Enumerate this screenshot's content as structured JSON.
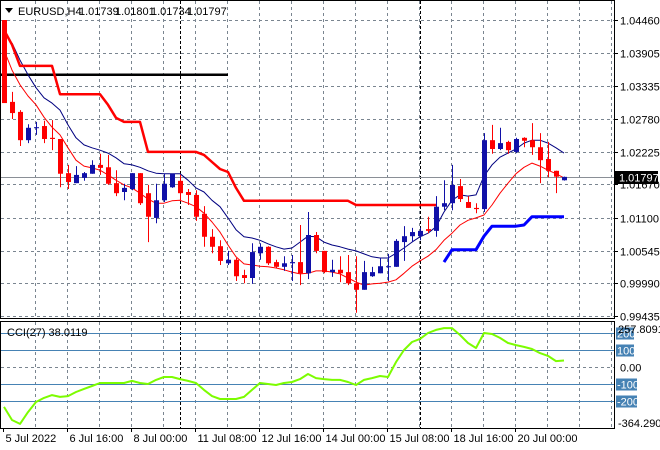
{
  "header": {
    "symbol": "EURUSD,H4",
    "open": "1.01739",
    "high": "1.01801",
    "low": "1.01734",
    "close": "1.01797"
  },
  "price_axis": {
    "labels": [
      "1.04460",
      "1.03905",
      "1.03335",
      "1.02780",
      "1.02225",
      "1.01670",
      "1.01100",
      "1.00545",
      "0.99990",
      "0.99435"
    ],
    "current_price": "1.01797"
  },
  "cci": {
    "title": "CCI(27) 38.0119",
    "max_label": "257.8091",
    "min_label": "-364.2903",
    "level_labels": [
      "200",
      "100",
      "0.00",
      "-100",
      "-200"
    ]
  },
  "time_axis": {
    "labels": [
      "5 Jul 2022",
      "6 Jul 16:00",
      "8 Jul 00:00",
      "11 Jul 08:00",
      "12 Jul 16:00",
      "14 Jul 00:00",
      "15 Jul 08:00",
      "18 Jul 16:00",
      "20 Jul 00:00"
    ]
  },
  "colors": {
    "bull": "#1010a8",
    "bear": "#ff0000",
    "ma_fast": "#ff0000",
    "ma_slow": "#000080",
    "resistance": "#ff0000",
    "support": "#0000ff",
    "cci_line": "#7cfc00",
    "cci_levels": "#4682b4",
    "grid": "#7a8590"
  },
  "chart_data": [
    {
      "type": "candlestick",
      "title": "EURUSD,H4",
      "ylim": [
        0.99435,
        1.0446
      ],
      "grid": true,
      "label_every": 8,
      "day_separators": [
        22,
        52
      ],
      "horizontal_line": 1.0353,
      "current_price": 1.01797,
      "ohlc": [
        [
          1.0446,
          1.0446,
          1.0305,
          1.0305
        ],
        [
          1.0307,
          1.0324,
          1.0278,
          1.0288
        ],
        [
          1.029,
          1.0293,
          1.0232,
          1.0242
        ],
        [
          1.0242,
          1.0269,
          1.0237,
          1.0263
        ],
        [
          1.0263,
          1.0273,
          1.0251,
          1.0264
        ],
        [
          1.0266,
          1.0275,
          1.0237,
          1.0244
        ],
        [
          1.0246,
          1.0276,
          1.0225,
          1.0244
        ],
        [
          1.0244,
          1.0244,
          1.0162,
          1.0185
        ],
        [
          1.0186,
          1.02,
          1.0159,
          1.0171
        ],
        [
          1.0169,
          1.0198,
          1.0169,
          1.0183
        ],
        [
          1.0178,
          1.0188,
          1.0173,
          1.0186
        ],
        [
          1.0185,
          1.0208,
          1.0185,
          1.02
        ],
        [
          1.02,
          1.0219,
          1.0183,
          1.0195
        ],
        [
          1.0196,
          1.0217,
          1.0166,
          1.0168
        ],
        [
          1.0169,
          1.0191,
          1.0147,
          1.0152
        ],
        [
          1.0154,
          1.0168,
          1.014,
          1.0161
        ],
        [
          1.0159,
          1.0186,
          1.0157,
          1.0186
        ],
        [
          1.0186,
          1.0186,
          1.0132,
          1.0135
        ],
        [
          1.0152,
          1.0166,
          1.0069,
          1.0112
        ],
        [
          1.011,
          1.0168,
          1.0101,
          1.014
        ],
        [
          1.014,
          1.0185,
          1.0137,
          1.0168
        ],
        [
          1.0162,
          1.0185,
          1.0161,
          1.0185
        ],
        [
          1.0173,
          1.0183,
          1.014,
          1.0152
        ],
        [
          1.0154,
          1.0159,
          1.0132,
          1.0149
        ],
        [
          1.0149,
          1.0157,
          1.0105,
          1.0112
        ],
        [
          1.0117,
          1.013,
          1.0061,
          1.0078
        ],
        [
          1.0078,
          1.0091,
          1.005,
          1.0061
        ],
        [
          1.0062,
          1.0072,
          1.003,
          1.0037
        ],
        [
          1.0033,
          1.0054,
          1.003,
          1.0039
        ],
        [
          1.0039,
          1.0042,
          1.0003,
          1.0011
        ],
        [
          1.0013,
          1.0022,
          0.9999,
          1.0008
        ],
        [
          1.0008,
          1.0067,
          0.9998,
          1.0052
        ],
        [
          1.005,
          1.0067,
          1.0039,
          1.0061
        ],
        [
          1.0061,
          1.0062,
          1.003,
          1.0033
        ],
        [
          1.0035,
          1.0039,
          1.0025,
          1.0027
        ],
        [
          1.0027,
          1.0045,
          1.002,
          1.0033
        ],
        [
          1.0033,
          1.0047,
          1.0003,
          1.0035
        ],
        [
          1.0035,
          1.0098,
          0.9996,
          1.0016
        ],
        [
          1.0016,
          1.012,
          1.0006,
          1.0081
        ],
        [
          1.0081,
          1.0086,
          1.005,
          1.0054
        ],
        [
          1.0054,
          1.0054,
          1.0016,
          1.0018
        ],
        [
          1.0018,
          1.0039,
          1.001,
          1.0022
        ],
        [
          1.0022,
          1.0045,
          1.0001,
          1.0016
        ],
        [
          1.0018,
          1.0047,
          0.9996,
          0.9999
        ],
        [
          0.9999,
          1.0045,
          0.9949,
          0.9988
        ],
        [
          0.9988,
          1.0037,
          0.9988,
          1.0018
        ],
        [
          1.0011,
          1.0027,
          1.001,
          1.0018
        ],
        [
          1.0016,
          1.0042,
          1.0016,
          1.0028
        ],
        [
          1.0027,
          1.0049,
          1.0003,
          1.0028
        ],
        [
          1.0027,
          1.0074,
          1.0027,
          1.0071
        ],
        [
          1.0069,
          1.0096,
          1.0037,
          1.0079
        ],
        [
          1.0079,
          1.0093,
          1.0069,
          1.0086
        ],
        [
          1.0079,
          1.0093,
          1.0072,
          1.0088
        ],
        [
          1.0091,
          1.0112,
          1.0084,
          1.0088
        ],
        [
          1.0088,
          1.0147,
          1.0078,
          1.0129
        ],
        [
          1.0129,
          1.0174,
          1.0123,
          1.0135
        ],
        [
          1.0135,
          1.02,
          1.0123,
          1.0166
        ],
        [
          1.0164,
          1.0176,
          1.0137,
          1.0142
        ],
        [
          1.0137,
          1.0147,
          1.0127,
          1.0127
        ],
        [
          1.0127,
          1.0135,
          1.0118,
          1.0125
        ],
        [
          1.0125,
          1.0254,
          1.012,
          1.0242
        ],
        [
          1.0242,
          1.0268,
          1.0219,
          1.0227
        ],
        [
          1.0227,
          1.0263,
          1.0225,
          1.0237
        ],
        [
          1.0239,
          1.0241,
          1.0219,
          1.0225
        ],
        [
          1.0222,
          1.0246,
          1.022,
          1.0244
        ],
        [
          1.0246,
          1.0247,
          1.023,
          1.0241
        ],
        [
          1.0242,
          1.0271,
          1.0217,
          1.023
        ],
        [
          1.023,
          1.0254,
          1.0169,
          1.0208
        ],
        [
          1.021,
          1.0239,
          1.0179,
          1.019
        ],
        [
          1.019,
          1.019,
          1.0152,
          1.018
        ],
        [
          1.01739,
          1.01801,
          1.01734,
          1.01797
        ]
      ],
      "series": [
        {
          "name": "ma_slow",
          "values": [
            null,
            1.0407,
            1.0378,
            1.0353,
            1.0331,
            1.0314,
            1.0305,
            1.0293,
            1.0268,
            1.0246,
            1.0234,
            1.0229,
            1.0225,
            1.022,
            1.0212,
            1.0202,
            1.02,
            1.0196,
            1.019,
            1.0186,
            1.0185,
            1.0185,
            1.0185,
            1.0174,
            1.0161,
            1.0154,
            1.014,
            1.0129,
            1.011,
            1.009,
            1.0078,
            1.0076,
            1.0072,
            1.0066,
            1.0061,
            1.0057,
            1.0059,
            1.0069,
            1.0079,
            1.0078,
            1.0069,
            1.0064,
            1.0061,
            1.0057,
            1.0054,
            1.0049,
            1.0044,
            1.0042,
            1.0042,
            1.005,
            1.0059,
            1.0069,
            1.0078,
            1.0084,
            1.0095,
            1.012,
            1.014,
            1.0149,
            1.0147,
            1.0149,
            1.0181,
            1.02,
            1.0213,
            1.022,
            1.0227,
            1.0237,
            1.0242,
            1.0242,
            1.0237,
            1.0229,
            1.022
          ]
        },
        {
          "name": "ma_fast",
          "values": [
            1.0395,
            1.0361,
            1.0336,
            1.0317,
            1.0302,
            1.0281,
            1.0264,
            1.0251,
            1.0229,
            1.0208,
            1.0198,
            1.0195,
            1.0191,
            1.0183,
            1.0174,
            1.0166,
            1.0161,
            1.0152,
            1.0142,
            1.0135,
            1.0135,
            1.0139,
            1.014,
            1.0135,
            1.0129,
            1.0118,
            1.0103,
            1.0086,
            1.0064,
            1.0044,
            1.0032,
            1.003,
            1.0028,
            1.0027,
            1.0025,
            1.0022,
            1.0018,
            1.0015,
            1.0016,
            1.002,
            1.002,
            1.0018,
            1.0015,
            1.0008,
            1.0001,
            0.9996,
            0.9998,
            0.9999,
            1.0001,
            1.0005,
            1.0016,
            1.0028,
            1.0037,
            1.0045,
            1.0056,
            1.0072,
            1.0084,
            1.0098,
            1.0106,
            1.011,
            1.0115,
            1.0132,
            1.0152,
            1.0169,
            1.0185,
            1.0196,
            1.0203,
            1.0198,
            1.0191,
            1.0185,
            1.0178
          ]
        },
        {
          "name": "resistance",
          "values": [
            1.0429,
            1.0404,
            1.0368,
            1.0368,
            1.0368,
            1.0368,
            1.0368,
            1.032,
            1.032,
            1.032,
            1.032,
            1.032,
            1.032,
            1.0302,
            1.028,
            1.0273,
            1.0273,
            1.0273,
            1.0222,
            1.0222,
            1.0222,
            1.0222,
            1.0222,
            1.0222,
            1.0222,
            1.0217,
            1.0205,
            1.0193,
            1.0188,
            1.0161,
            1.0139,
            1.0139,
            1.0139,
            1.0139,
            1.0139,
            1.0139,
            1.0139,
            1.0139,
            1.0139,
            1.0139,
            1.0139,
            1.0139,
            1.0139,
            1.0139,
            1.0132,
            1.0132,
            1.0132,
            1.0132,
            1.0132,
            1.0132,
            1.0132,
            1.0132,
            1.0132,
            1.0132,
            1.0132,
            null,
            null,
            null,
            null,
            null,
            null,
            null,
            null,
            null,
            null,
            null,
            null,
            null,
            null,
            null,
            null
          ]
        },
        {
          "name": "support",
          "values": [
            null,
            null,
            null,
            null,
            null,
            null,
            null,
            null,
            null,
            null,
            null,
            null,
            null,
            null,
            null,
            null,
            null,
            null,
            null,
            null,
            null,
            null,
            null,
            null,
            null,
            null,
            null,
            null,
            null,
            null,
            null,
            null,
            null,
            null,
            null,
            null,
            null,
            null,
            null,
            null,
            null,
            null,
            null,
            null,
            null,
            null,
            null,
            null,
            null,
            null,
            null,
            null,
            null,
            null,
            null,
            1.0035,
            1.0056,
            1.0056,
            1.0056,
            1.0056,
            1.0079,
            1.0096,
            1.0096,
            1.0096,
            1.0096,
            1.0098,
            1.0112,
            1.0112,
            1.0112,
            1.0112,
            1.0112
          ]
        }
      ]
    },
    {
      "type": "line",
      "title": "CCI(27) 38.0119",
      "ylim": [
        -364.2903,
        257.8091
      ],
      "levels": [
        200,
        100,
        0,
        -100,
        -200
      ],
      "values": [
        -235,
        -312,
        -335,
        -265,
        -206,
        -182,
        -165,
        -176,
        -171,
        -147,
        -129,
        -112,
        -94,
        -94,
        -94,
        -94,
        -82,
        -94,
        -100,
        -76,
        -59,
        -59,
        -71,
        -82,
        -94,
        -135,
        -171,
        -188,
        -188,
        -188,
        -176,
        -135,
        -94,
        -100,
        -106,
        -94,
        -88,
        -71,
        -41,
        -65,
        -71,
        -76,
        -76,
        -88,
        -106,
        -76,
        -65,
        -53,
        -59,
        29,
        100,
        147,
        165,
        200,
        218,
        229,
        229,
        188,
        141,
        112,
        200,
        194,
        171,
        141,
        129,
        118,
        106,
        82,
        65,
        35,
        38.0119
      ]
    }
  ]
}
